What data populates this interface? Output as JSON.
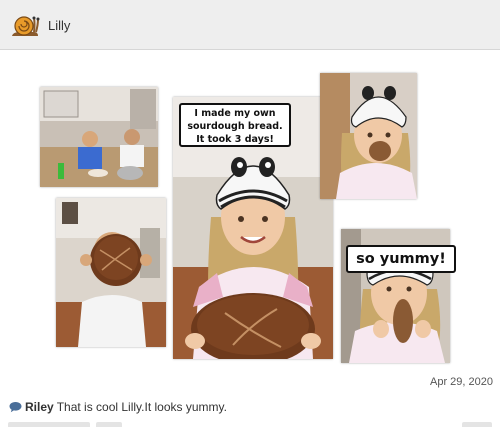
{
  "post": {
    "author": "Lilly",
    "date": "Apr 29, 2020",
    "captions": {
      "first_lines": [
        "I made my own",
        "sourdough bread.",
        "It took 3 days!"
      ],
      "second": "so yummy!"
    }
  },
  "comment": {
    "author": "Riley",
    "text": "That is cool Lilly.It looks yummy."
  },
  "icons": {
    "avatar": "snail-icon",
    "comment": "speech-bubble-icon"
  },
  "colors": {
    "header_bg": "#eeeeee",
    "photo_wood_floor": "#a0613b",
    "bread_crust": "#6e3a1c"
  }
}
